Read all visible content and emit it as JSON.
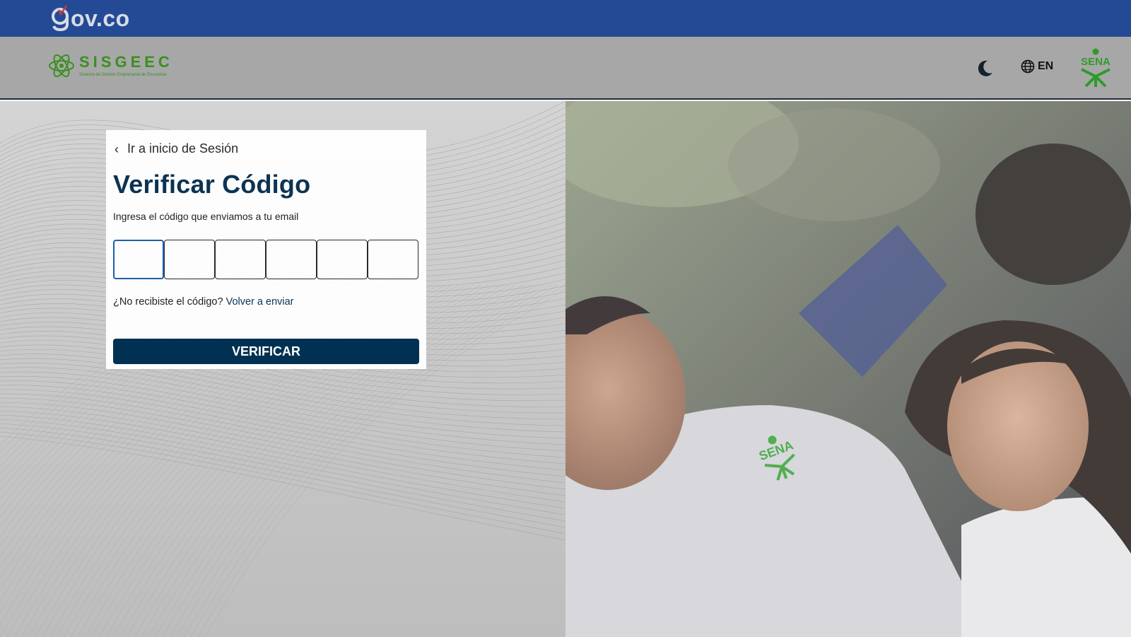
{
  "gov_bar": {
    "logo_text": "ov.co",
    "logo_icon": "gov-co-logo"
  },
  "header": {
    "brand_name": "SISGEEC",
    "brand_subtitle": "Sistema de Gestión Empresarial de Encuestas",
    "brand_icon": "atom-icon",
    "theme_icon": "moon-icon",
    "language_icon": "globe-icon",
    "language_label": "EN",
    "partner_logo_text": "SENA"
  },
  "card": {
    "back_label": "Ir a inicio de Sesión",
    "title": "Verificar Código",
    "subtitle": "Ingresa el código que enviamos a tu email",
    "code_length": 6,
    "resend_prompt": "¿No recibiste el código?",
    "resend_link": "Volver a enviar",
    "verify_label": "VERIFICAR"
  },
  "colors": {
    "gov_bar": "#244a95",
    "header_bg": "#a7a7a7",
    "brand_green": "#3a8f1e",
    "primary": "#003152",
    "title": "#0c3352"
  }
}
